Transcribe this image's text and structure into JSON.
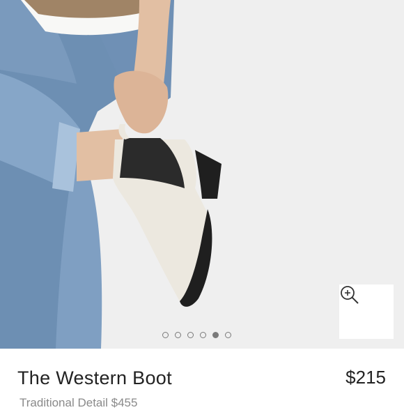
{
  "product": {
    "title": "The Western Boot",
    "price": "$215",
    "traditional_detail": "Traditional Detail $455"
  },
  "gallery": {
    "image_count": 6,
    "active_index": 4,
    "zoom_icon": "zoom-in-icon",
    "image_subject": "person wearing cream and black western ankle boot with light-wash jeans"
  },
  "colors": {
    "background": "#efefef",
    "dot": "#7a7a7a",
    "text": "#222222",
    "muted_text": "#8a8a8a"
  }
}
